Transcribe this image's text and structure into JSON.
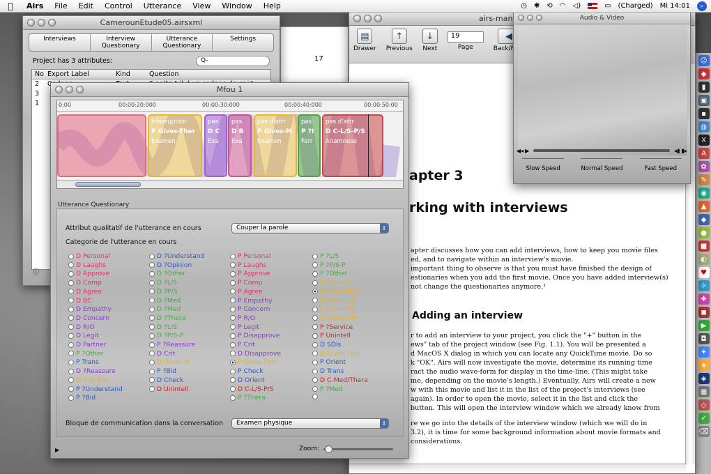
{
  "menubar": {
    "app": "Airs",
    "items": [
      "File",
      "Edit",
      "Control",
      "Utterance",
      "View",
      "Window",
      "Help"
    ],
    "battery": "(Charged)",
    "clock": "Mi 14:01"
  },
  "project_window": {
    "title": "CamerounEtude05.airsxml",
    "tabs": [
      "Interviews",
      "Interview Questionary",
      "Utterance Questionary",
      "Settings"
    ],
    "info": "Project has 3 attributes:",
    "search_placeholder": "Q-",
    "columns": [
      "No",
      "Export Label",
      "Kind",
      "Question"
    ],
    "rows": [
      {
        "no": "2",
        "label": "Codage",
        "kind": "Text",
        "question": "S agite-t-il d un codage de cont..."
      },
      {
        "no": "3",
        "label": "",
        "kind": "",
        "question": ""
      },
      {
        "no": "1",
        "label": "",
        "kind": "",
        "question": ""
      }
    ],
    "page_number": "17"
  },
  "manual_window": {
    "title": "airs-manu",
    "tools": {
      "drawer": "Drawer",
      "previous": "Previous",
      "next": "Next",
      "page": "Page",
      "backfore": "Back/Fore"
    },
    "page_value": "19",
    "chapter": "apter 3",
    "chapter_title": "rking with interviews",
    "paragraphs": [
      "apter discusses how you can add interviews, how to keep you movie files",
      "ed, and to navigate within an interview's movie.",
      "important thing to observe is that you must have finished the design of",
      "estionaries when you add the first movie. Once you have added interview(s)",
      "not change the questionaries anymore.¹"
    ],
    "section": "Adding an interview",
    "body": [
      "r to add an interview to your project, you click the \"+\" button in the",
      "ews\" tab of the project window (see Fig. 1.1). You will be presented a",
      "d MacOS X dialog in which you can locate any QuickTime movie. Do so",
      "k \"OK\". Airs will now investigate the movie, determine its running time",
      "ract the audio wave-form for display in the time-line. (This might take",
      "me, depending on the movie's length.) Eventually, Airs will create a new",
      "w with this movie and list it in the list of the project's interviews (see",
      "again). In order to open the movie, select it in the list and click the",
      "button. This will open the interview window which we already know from",
      "",
      "re we go into the details of the interview window (which we will do in",
      "3.2), it is time for some background information about movie formats and",
      "considerations."
    ]
  },
  "av_window": {
    "title": "Audio & Video",
    "speeds": [
      "Slow Speed",
      "Normal Speed",
      "Fast Speed"
    ]
  },
  "interview_window": {
    "title": "Mfou 1",
    "ruler": [
      "0:00",
      "00:00:20:000",
      "00:00:30:000",
      "00:00:40:000",
      "00:00:50:00"
    ],
    "segments": [
      {
        "top": "",
        "line1": "",
        "line2": "",
        "color": "#e06a80"
      },
      {
        "top": "Interruption",
        "line1": "P Gives-Ther",
        "line2": "Examen",
        "color": "#e8b830"
      },
      {
        "top": "pas",
        "line1": "D C",
        "line2": "Exa",
        "color": "#a060d0"
      },
      {
        "top": "pas",
        "line1": "D B",
        "line2": "Exa",
        "color": "#d05090"
      },
      {
        "top": "pas d'attr",
        "line1": "P Gives-M",
        "line2": "Examen",
        "color": "#e8b830"
      },
      {
        "top": "pas",
        "line1": "P ?I",
        "line2": "Ferr",
        "color": "#50a040"
      },
      {
        "top": "pas d'attr",
        "line1": "D C-L/S-P/S",
        "line2": "Anamnese",
        "color": "#c84848"
      }
    ],
    "uq_label": "Utterance Questionary",
    "attr_label": "Attribut qualitatif de l'utterance en cours",
    "attr_value": "Couper la parole",
    "cat_label": "Categorie de l'utterance en cours",
    "categories": [
      [
        {
          "t": "D Personal",
          "c": "#e0306a"
        },
        {
          "t": "D Laughs",
          "c": "#e0306a"
        },
        {
          "t": "D Approve",
          "c": "#e0306a"
        },
        {
          "t": "D Comp",
          "c": "#e0306a"
        },
        {
          "t": "D Agree",
          "c": "#e0306a"
        },
        {
          "t": "D BC",
          "c": "#e0306a"
        },
        {
          "t": "D Empathy",
          "c": "#8a3ad0"
        },
        {
          "t": "D Concern",
          "c": "#8a3ad0"
        },
        {
          "t": "D R/O",
          "c": "#8a3ad0"
        },
        {
          "t": "D Legit",
          "c": "#8a3ad0"
        },
        {
          "t": "D Partner",
          "c": "#8a3ad0"
        },
        {
          "t": "P ?Other",
          "c": "#48a848"
        },
        {
          "t": "P Trans",
          "c": "#3058c0"
        },
        {
          "t": "D ?Reassure",
          "c": "#8a3ad0"
        },
        {
          "t": "D Self-Disc",
          "c": "#e8b020"
        },
        {
          "t": "P ?Understand",
          "c": "#3058c0"
        },
        {
          "t": "P ?Bid",
          "c": "#3058c0"
        }
      ],
      [
        {
          "t": "D ?Understand",
          "c": "#3058c0"
        },
        {
          "t": "D ?Opinion",
          "c": "#3058c0"
        },
        {
          "t": "D ?Other",
          "c": "#48a848"
        },
        {
          "t": "D ?L/S",
          "c": "#48a848"
        },
        {
          "t": "D ?P/S",
          "c": "#48a848"
        },
        {
          "t": "D ?Med",
          "c": "#48a848"
        },
        {
          "t": "D ?Med",
          "c": "#48a848"
        },
        {
          "t": "D ?Thera",
          "c": "#48a848"
        },
        {
          "t": "D ?L/S",
          "c": "#48a848"
        },
        {
          "t": "D ?P/S-P",
          "c": "#48a848"
        },
        {
          "t": "P ?Reassure",
          "c": "#8a3ad0"
        },
        {
          "t": "D Crit",
          "c": "#8a3ad0"
        },
        {
          "t": "D Gives-M",
          "c": "#e8b020"
        },
        {
          "t": "P ?Bid",
          "c": "#3058c0"
        },
        {
          "t": "D Check",
          "c": "#3058c0"
        },
        {
          "t": "D Unintell",
          "c": "#c02828"
        }
      ],
      [
        {
          "t": "P Personal",
          "c": "#e0306a"
        },
        {
          "t": "P Laughs",
          "c": "#e0306a"
        },
        {
          "t": "P Approve",
          "c": "#e0306a"
        },
        {
          "t": "P Comp",
          "c": "#e0306a"
        },
        {
          "t": "P Agree",
          "c": "#e0306a"
        },
        {
          "t": "P Empathy",
          "c": "#8a3ad0"
        },
        {
          "t": "P Concern",
          "c": "#8a3ad0"
        },
        {
          "t": "P R/O",
          "c": "#8a3ad0"
        },
        {
          "t": "P Legit",
          "c": "#8a3ad0"
        },
        {
          "t": "P Disapprove",
          "c": "#8a3ad0"
        },
        {
          "t": "P Crit",
          "c": "#8a3ad0"
        },
        {
          "t": "D Disapprove",
          "c": "#8a3ad0"
        },
        {
          "t": "P Gives-Ther",
          "c": "#e8b020"
        },
        {
          "t": "P Check",
          "c": "#3058c0"
        },
        {
          "t": "D Orient",
          "c": "#3058c0"
        },
        {
          "t": "D C-L/S-P/S",
          "c": "#c02828"
        },
        {
          "t": "P ?Thera",
          "c": "#48a848"
        }
      ],
      [
        {
          "t": "P ?L/S",
          "c": "#48a848"
        },
        {
          "t": "P ?P/S-P",
          "c": "#48a848"
        },
        {
          "t": "P ?Other",
          "c": "#48a848"
        },
        {
          "t": "P Gives-M",
          "c": "#e8b020"
        },
        {
          "t": "P Gives-Ther",
          "c": "#e8b020"
        },
        {
          "t": "P Gives-L/S",
          "c": "#e8b020"
        },
        {
          "t": "P Gives-P/S",
          "c": "#e8b020"
        },
        {
          "t": "P Gives-Oth",
          "c": "#e8b020"
        },
        {
          "t": "P ?Service",
          "c": "#c02828"
        },
        {
          "t": "P Unintell",
          "c": "#c02828"
        },
        {
          "t": "D SDis",
          "c": "#3058c0"
        },
        {
          "t": "D Gives-Ther",
          "c": "#e8b020"
        },
        {
          "t": "P Orient",
          "c": "#3058c0"
        },
        {
          "t": "D Trans",
          "c": "#3058c0"
        },
        {
          "t": "D C-Med/Thera",
          "c": "#c02828"
        },
        {
          "t": "P ?Med",
          "c": "#48a848"
        },
        {
          "t": "",
          "c": "#c02828"
        }
      ]
    ],
    "checked": "P Gives-Ther",
    "bloc_label": "Bloque de communication dans la conversation",
    "bloc_value": "Examen physique",
    "zoom_label": "Zoom:"
  }
}
